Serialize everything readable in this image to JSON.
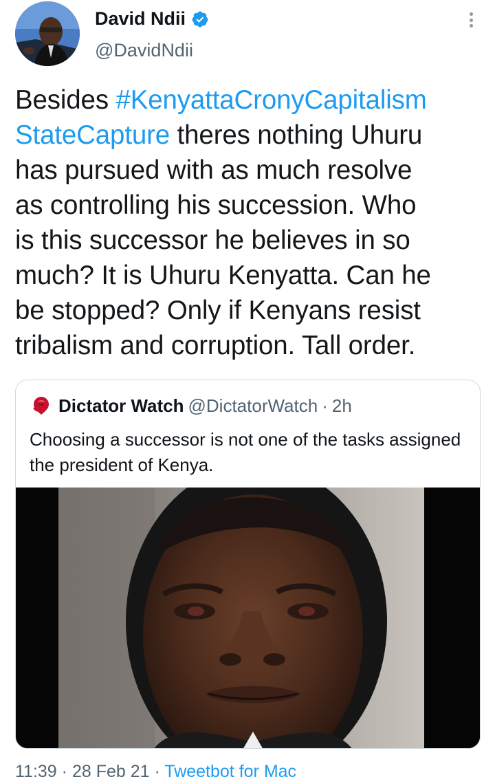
{
  "author": {
    "name": "David Ndii",
    "handle": "@DavidNdii",
    "verified": true
  },
  "tweet": {
    "lines": [
      [
        {
          "text": "Besides ",
          "hashtag": false
        },
        {
          "text": "#KenyattaCronyCapitalism",
          "hashtag": true
        }
      ],
      [
        {
          "text": "StateCapture",
          "hashtag": true
        },
        {
          "text": "  theres nothing Uhuru",
          "hashtag": false
        }
      ],
      [
        {
          "text": "has pursued with as much resolve",
          "hashtag": false
        }
      ],
      [
        {
          "text": "as controlling his succession. Who",
          "hashtag": false
        }
      ],
      [
        {
          "text": "is this successor he believes in so",
          "hashtag": false
        }
      ],
      [
        {
          "text": "much? It is Uhuru Kenyatta. Can he",
          "hashtag": false
        }
      ],
      [
        {
          "text": "be stopped? Only if Kenyans resist",
          "hashtag": false
        }
      ],
      [
        {
          "text": "tribalism and corruption. Tall order.",
          "hashtag": false
        }
      ]
    ]
  },
  "quote": {
    "name": "Dictator Watch",
    "handle": "@DictatorWatch",
    "separator": "·",
    "time": "2h",
    "text": "Choosing a successor is not one of the tasks assigned the president of Kenya."
  },
  "meta": {
    "time": "11:39",
    "date": "28 Feb 21",
    "separator": " · ",
    "source": "Tweetbot for Mac"
  },
  "colors": {
    "link": "#1d9bf0",
    "secondary_text": "#536471",
    "border": "#cfd9de"
  },
  "icons": [
    "verified-badge-icon",
    "more-options-icon",
    "rose-icon"
  ]
}
